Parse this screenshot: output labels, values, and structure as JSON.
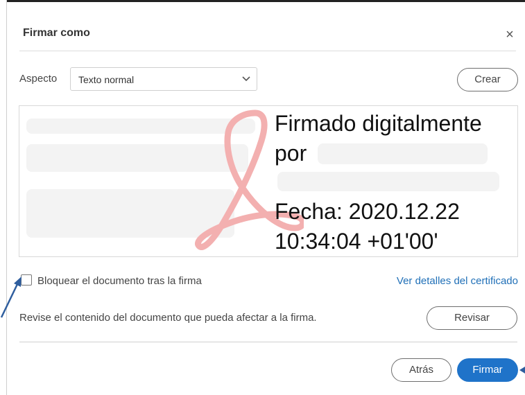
{
  "dialog": {
    "title": "Firmar como",
    "close_glyph": "×"
  },
  "appearance": {
    "label": "Aspecto",
    "selected": "Texto normal",
    "create_label": "Crear"
  },
  "signature_preview": {
    "lines": [
      "Firmado digitalmente",
      "por",
      "",
      "Fecha: 2020.12.22",
      "10:34:04 +01'00'"
    ]
  },
  "lock": {
    "checked": false,
    "label": "Bloquear el documento tras la firma"
  },
  "certificate_link": "Ver detalles del certificado",
  "review": {
    "text": "Revise el contenido del documento que pueda afectar a la firma.",
    "button_label": "Revisar"
  },
  "footer": {
    "back_label": "Atrás",
    "sign_label": "Firmar"
  },
  "colors": {
    "accent": "#1f73c9",
    "link": "#1f6fb7",
    "annotation_arrow": "#2f5e9e",
    "logo": "#f3b0b0"
  },
  "icons": [
    "close-icon",
    "chevron-down-icon",
    "acrobat-logo-icon",
    "annotation-arrow-icon"
  ]
}
